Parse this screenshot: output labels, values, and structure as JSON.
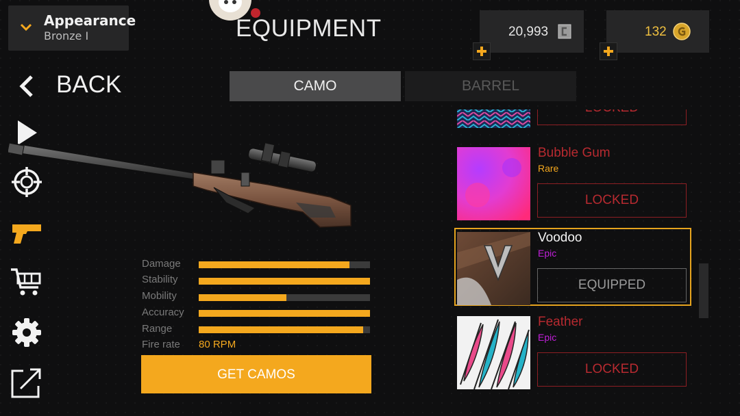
{
  "profile": {
    "name": "Appearance",
    "rank": "Bronze I"
  },
  "header": {
    "title": "EQUIPMENT"
  },
  "currency": [
    {
      "value": "20,993",
      "icon": "credits-icon"
    },
    {
      "value": "132",
      "icon": "gold-coin-icon"
    }
  ],
  "nav": {
    "back_label": "BACK"
  },
  "tabs": [
    {
      "label": "CAMO",
      "active": true
    },
    {
      "label": "BARREL",
      "active": false
    }
  ],
  "sidebar": [
    "play-icon",
    "crosshair-icon",
    "pistol-icon",
    "cart-icon",
    "gear-icon",
    "external-link-icon"
  ],
  "stats": {
    "items": [
      {
        "label": "Damage",
        "value": 0.88
      },
      {
        "label": "Stability",
        "value": 1.0
      },
      {
        "label": "Mobility",
        "value": 0.51
      },
      {
        "label": "Accuracy",
        "value": 1.0
      },
      {
        "label": "Range",
        "value": 0.96
      }
    ],
    "fire_rate_label": "Fire rate",
    "fire_rate_value": "80 RPM"
  },
  "get_camos_label": "GET CAMOS",
  "camos": [
    {
      "name": "",
      "rarity": "",
      "button": "LOCKED",
      "state": "locked"
    },
    {
      "name": "Bubble Gum",
      "rarity": "Rare",
      "button": "LOCKED",
      "state": "locked"
    },
    {
      "name": "Voodoo",
      "rarity": "Epic",
      "button": "EQUIPPED",
      "state": "equipped"
    },
    {
      "name": "Feather",
      "rarity": "Epic",
      "button": "LOCKED",
      "state": "locked"
    }
  ],
  "colors": {
    "accent": "#f4a81e",
    "locked": "#b82a30",
    "epic": "#c020d8",
    "rare": "#f4a81e"
  }
}
